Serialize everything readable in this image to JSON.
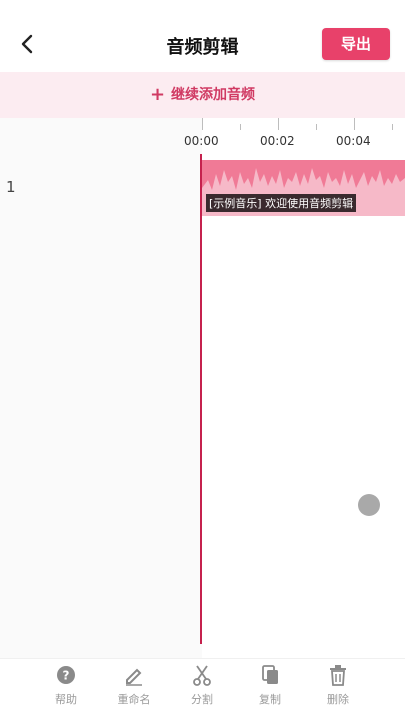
{
  "header": {
    "title": "音频剪辑",
    "export_label": "导出"
  },
  "add_bar": {
    "label": "继续添加音频",
    "plus": "+"
  },
  "timeline": {
    "track_number": "1",
    "ticks": [
      "00:00",
      "00:02",
      "00:04"
    ],
    "clip_label": "[示例音乐] 欢迎使用音频剪辑"
  },
  "toolbar": {
    "items": [
      {
        "label": "帮助",
        "icon": "help-icon"
      },
      {
        "label": "重命名",
        "icon": "pencil-icon"
      },
      {
        "label": "分割",
        "icon": "scissors-icon"
      },
      {
        "label": "复制",
        "icon": "copy-icon"
      },
      {
        "label": "删除",
        "icon": "trash-icon"
      }
    ]
  },
  "colors": {
    "accent": "#e8416a",
    "clip": "#f07a96",
    "playhead": "#c5214d",
    "add_bar_bg": "#fcecf1"
  }
}
